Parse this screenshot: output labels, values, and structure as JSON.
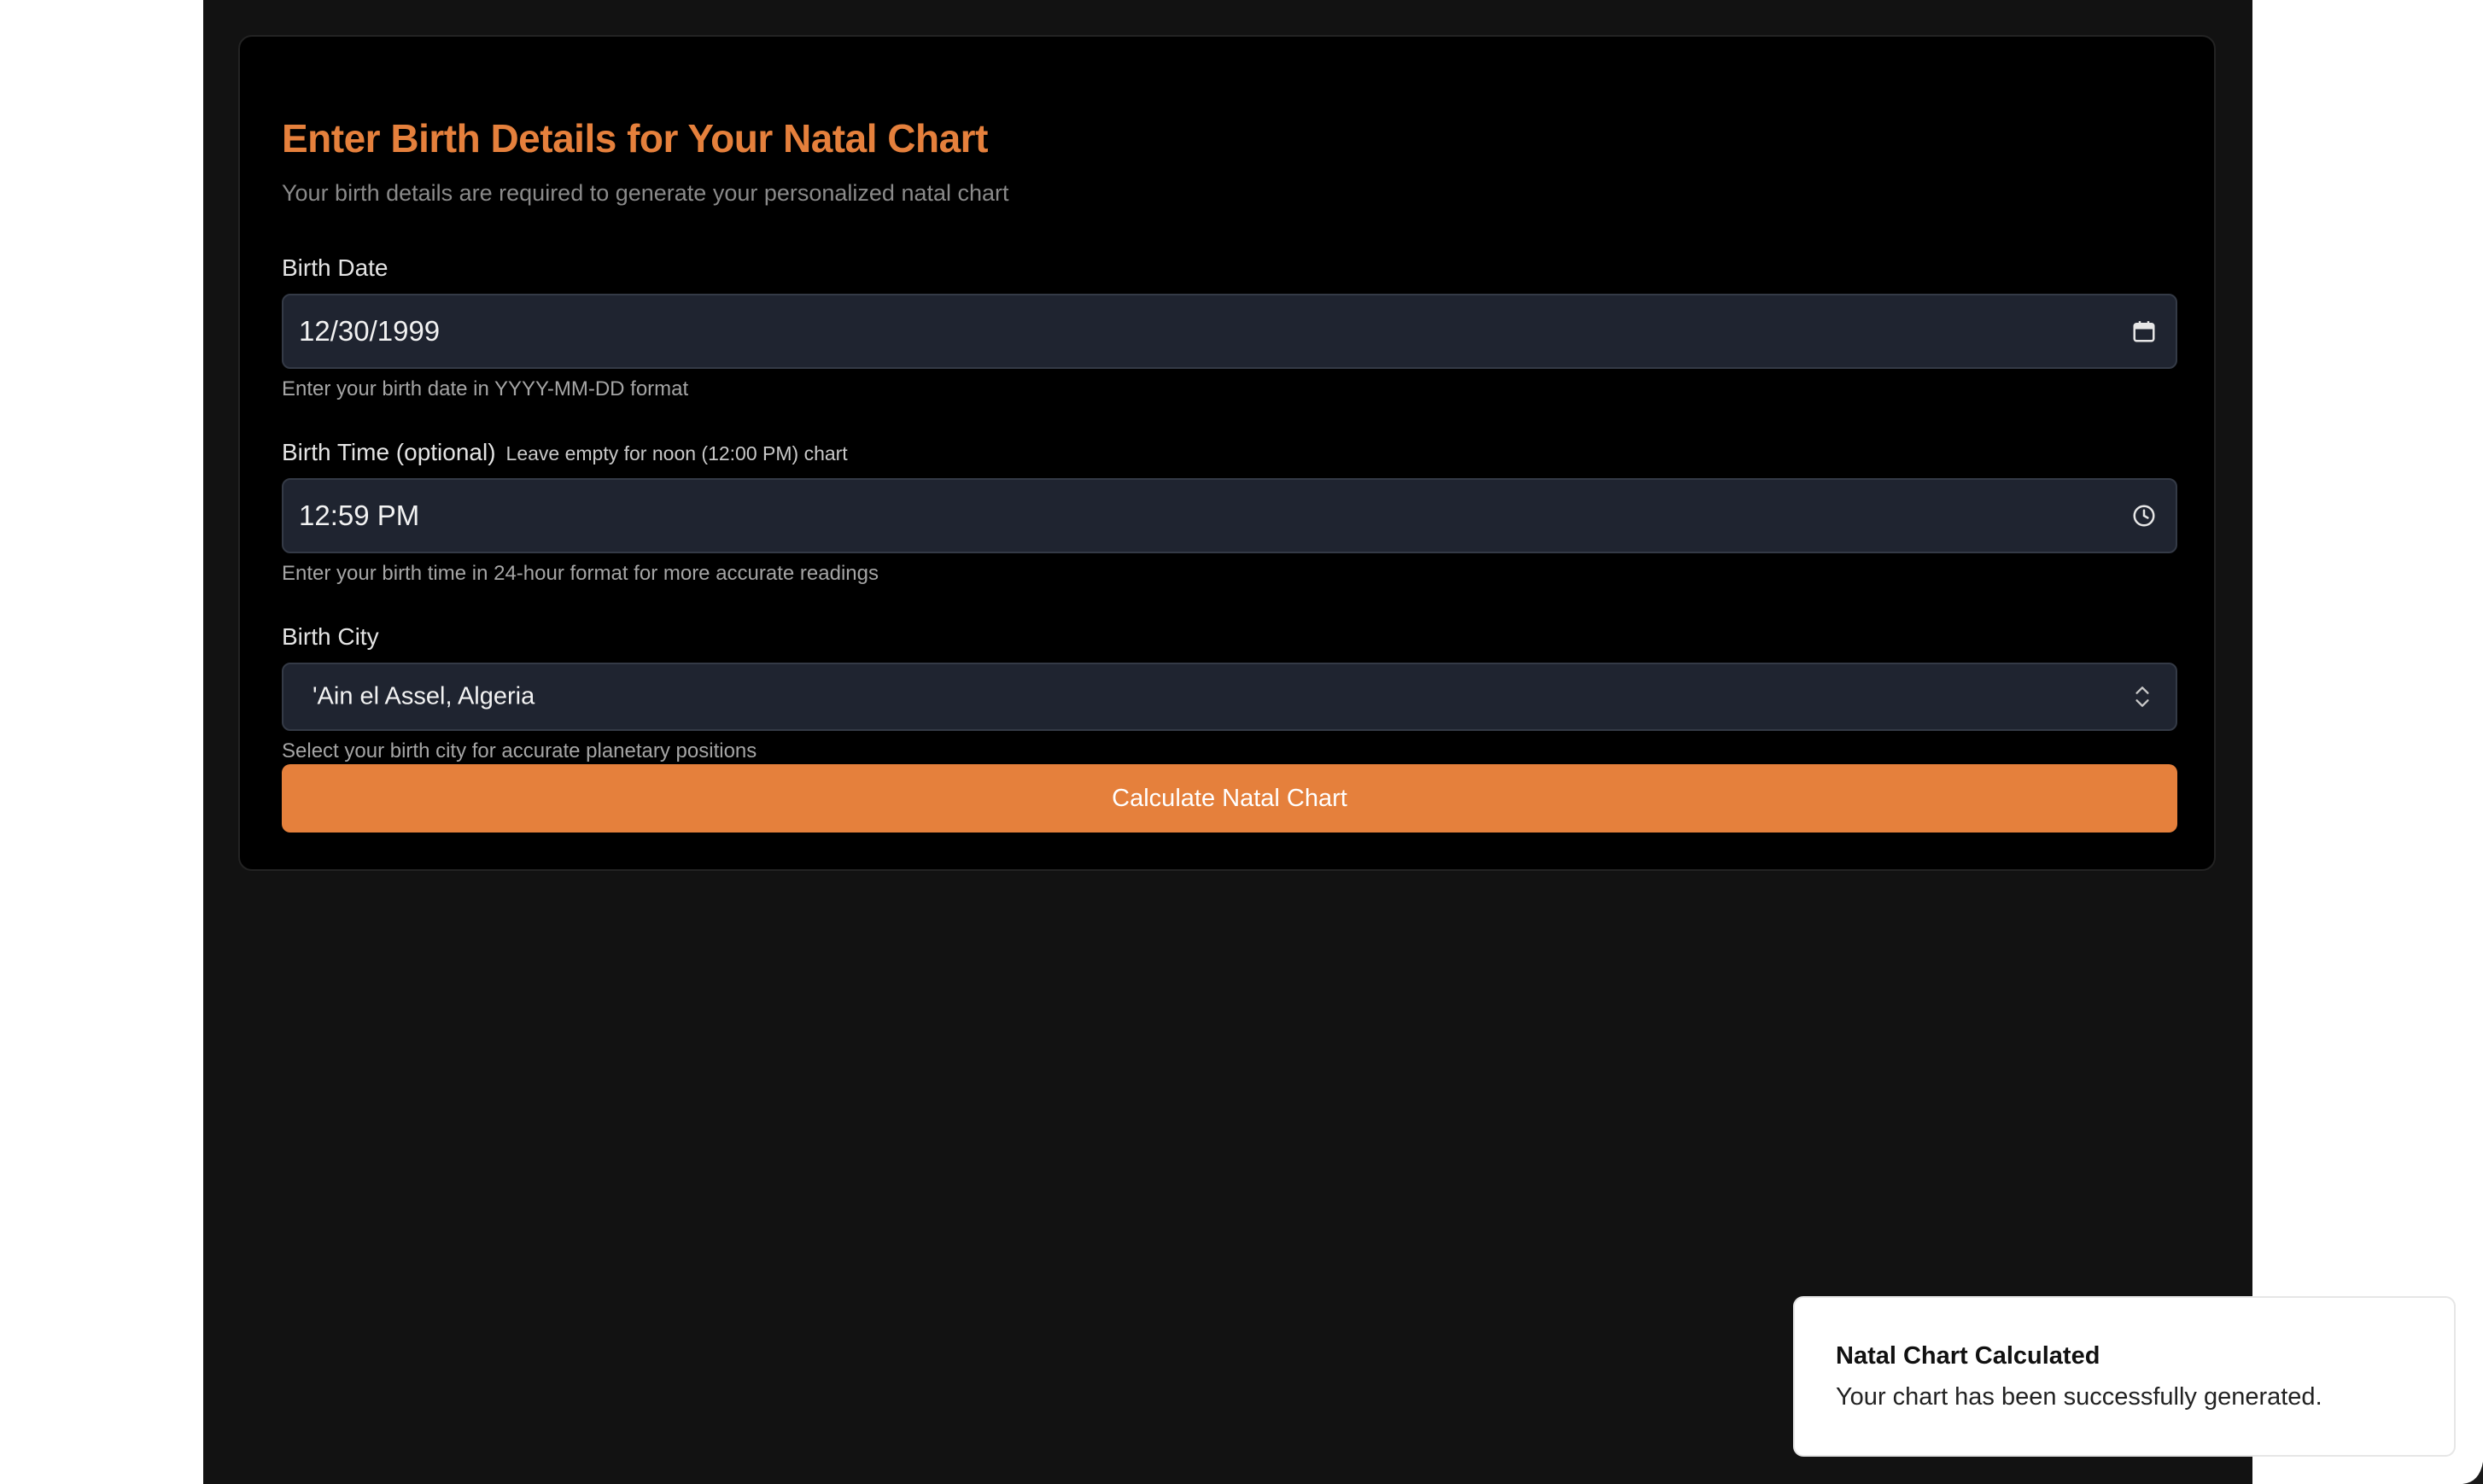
{
  "form": {
    "title": "Enter Birth Details for Your Natal Chart",
    "subtitle": "Your birth details are required to generate your personalized natal chart",
    "birth_date": {
      "label": "Birth Date",
      "value": "12/30/1999",
      "help": "Enter your birth date in YYYY-MM-DD format",
      "icon": "calendar-icon"
    },
    "birth_time": {
      "label": "Birth Time (optional)",
      "note": "Leave empty for noon (12:00 PM) chart",
      "value": "12:59 PM",
      "help": "Enter your birth time in 24-hour format for more accurate readings",
      "icon": "clock-icon"
    },
    "birth_city": {
      "label": "Birth City",
      "value": "'Ain el Assel, Algeria",
      "help": "Select your birth city for accurate planetary positions",
      "icon": "chevron-up-down-icon"
    },
    "submit_label": "Calculate Natal Chart"
  },
  "toast": {
    "title": "Natal Chart Calculated",
    "message": "Your chart has been successfully generated."
  },
  "colors": {
    "accent": "#e5803c",
    "page_background": "#121212",
    "card_background": "#000000",
    "field_background": "#1f2430",
    "toast_background": "#ffffff"
  }
}
